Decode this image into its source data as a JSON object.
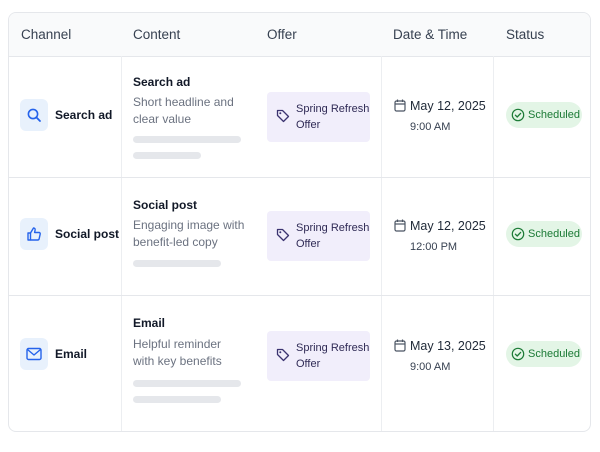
{
  "headers": {
    "channel": "Channel",
    "content": "Content",
    "offer": "Offer",
    "datetime": "Date & Time",
    "status": "Status"
  },
  "rows": [
    {
      "channel": "Search ad",
      "channel_icon": "search-icon",
      "content_title": "Search ad",
      "content_desc": "Short headline and clear value",
      "offer": "Spring Refresh Offer",
      "date": "May 12, 2025",
      "time": "9:00 AM",
      "status": "Scheduled"
    },
    {
      "channel": "Social post",
      "channel_icon": "thumbs-up-icon",
      "content_title": "Social post",
      "content_desc": "Engaging image with benefit-led copy",
      "offer": "Spring Refresh Offer",
      "date": "May 12, 2025",
      "time": "12:00 PM",
      "status": "Scheduled"
    },
    {
      "channel": "Email",
      "channel_icon": "mail-icon",
      "content_title": "Email",
      "content_desc": "Helpful reminder with key benefits",
      "offer": "Spring Refresh Offer",
      "date": "May 13, 2025",
      "time": "9:00 AM",
      "status": "Scheduled"
    }
  ],
  "colors": {
    "accent_blue": "#2563eb",
    "offer_bg": "#f1eefb",
    "status_bg": "#e3f5e6",
    "status_text": "#1b7a35"
  }
}
